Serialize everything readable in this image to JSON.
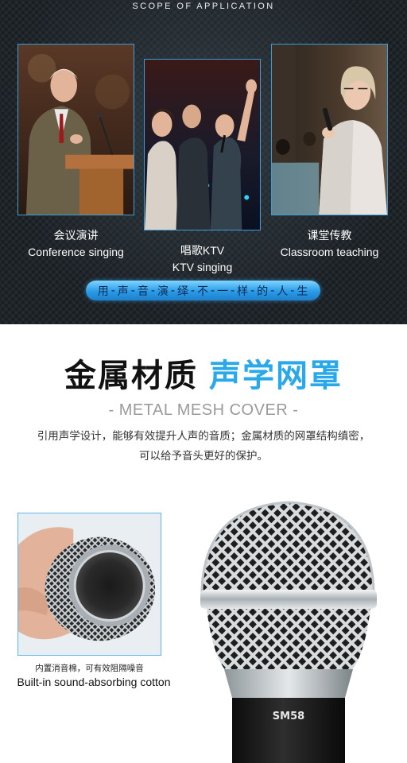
{
  "scope": {
    "title": "SCOPE OF APPLICATION",
    "items": [
      {
        "zh": "会议演讲",
        "en": "Conference singing"
      },
      {
        "zh": "唱歌KTV",
        "en": "KTV singing"
      },
      {
        "zh": "课堂传教",
        "en": "Classroom teaching"
      }
    ],
    "slogan": [
      "用",
      "声",
      "音",
      "演",
      "绎",
      "不",
      "一",
      "样",
      "的",
      "人",
      "生"
    ]
  },
  "mesh": {
    "heading_black": "金属材质",
    "heading_blue": "声学网罩",
    "subheading": "- METAL MESH COVER -",
    "desc_line1": "引用声学设计，能够有效提升人声的音质；金属材质的网罩结构缜密，",
    "desc_line2": "可以给予音头更好的保护。",
    "inset_caption_zh": "内置消音棉，可有效阻隔噪音",
    "inset_caption_en": "Built-in sound-absorbing cotton",
    "mic_model": "SM58"
  },
  "colors": {
    "accent_blue": "#2aa9ea",
    "dark_bg": "#1e2429",
    "frame_blue": "#3a9fd8"
  }
}
